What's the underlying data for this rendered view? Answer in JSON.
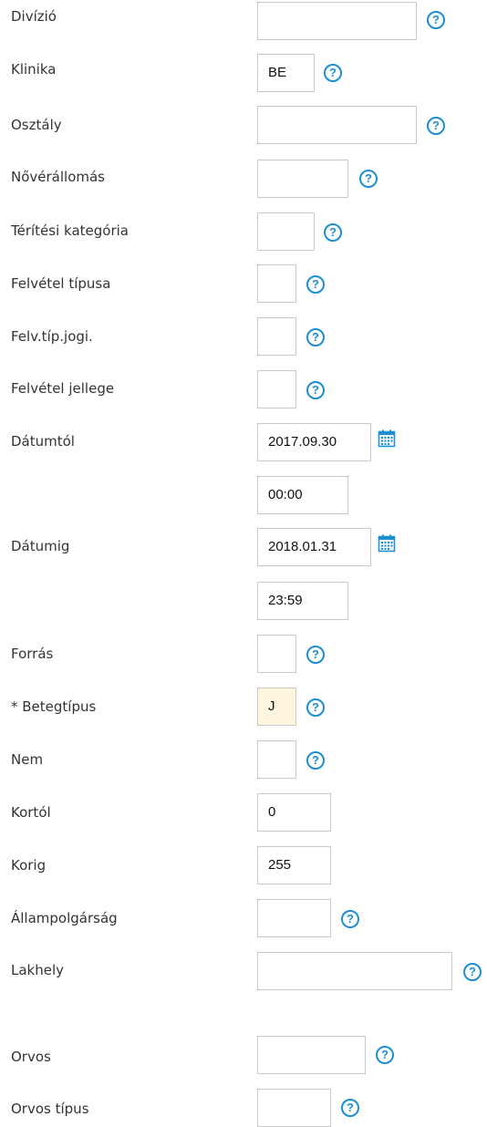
{
  "fields": {
    "divizio": {
      "label": "Divízió",
      "value": ""
    },
    "klinika": {
      "label": "Klinika",
      "value": "BE"
    },
    "osztaly": {
      "label": "Osztály",
      "value": ""
    },
    "noverallomas": {
      "label": "Nővérállomás",
      "value": ""
    },
    "teritesi": {
      "label": "Térítési kategória",
      "value": ""
    },
    "felvetel_tipusa": {
      "label": "Felvétel típusa",
      "value": ""
    },
    "felv_tip_jogi": {
      "label": "Felv.típ.jogi.",
      "value": ""
    },
    "felvetel_jellege": {
      "label": "Felvétel jellege",
      "value": ""
    },
    "datumtol": {
      "label": "Dátumtól",
      "date": "2017.09.30",
      "time": "00:00"
    },
    "datumig": {
      "label": "Dátumig",
      "date": "2018.01.31",
      "time": "23:59"
    },
    "forras": {
      "label": "Forrás",
      "value": ""
    },
    "betegtipus": {
      "label": "* Betegtípus",
      "value": "J"
    },
    "nem": {
      "label": "Nem",
      "value": ""
    },
    "kortol": {
      "label": "Kortól",
      "value": "0"
    },
    "korig": {
      "label": "Korig",
      "value": "255"
    },
    "allampolgarsag": {
      "label": "Állampolgárság",
      "value": ""
    },
    "lakhely": {
      "label": "Lakhely",
      "value": ""
    },
    "orvos": {
      "label": "Orvos",
      "value": ""
    },
    "orvos_tipus": {
      "label": "Orvos típus",
      "value": ""
    }
  },
  "icons": {
    "help": "help-circle-icon",
    "calendar": "calendar-icon",
    "help_glyph": "?"
  },
  "colors": {
    "accent": "#1c8fcf",
    "required_bg": "#fdf5dd",
    "label_text": "#333333",
    "border": "#c9c9c9"
  }
}
